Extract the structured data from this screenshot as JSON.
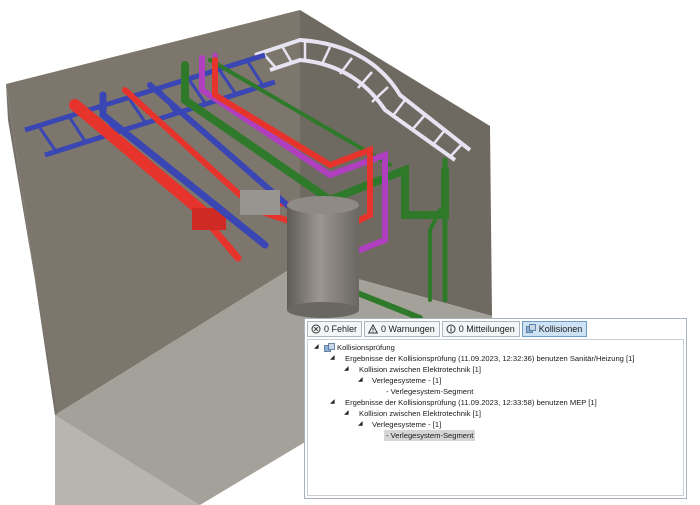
{
  "toolbar": {
    "errors": "0 Fehler",
    "warnings": "0 Warnungen",
    "messages": "0 Mitteilungen",
    "collisions": "Kollisionen"
  },
  "tree": {
    "root": "Kollisionsprüfung",
    "result1": "Ergebnisse der Kollisionsprüfung (11.09.2023, 12:32:36) benutzen Sanitär/Heizung [1]",
    "result1_collision": "Kollision zwischen Elektrotechnik [1]",
    "result1_systems": "Verlegesysteme -  [1]",
    "result1_segment": "- Verlegesystem-Segment",
    "result2": "Ergebnisse der Kollisionsprüfung (11.09.2023, 12:33:58) benutzen MEP [1]",
    "result2_collision": "Kollision zwischen Elektrotechnik [1]",
    "result2_systems": "Verlegesysteme -  [1]",
    "result2_segment": "- Verlegesystem-Segment"
  },
  "colors": {
    "wall": "#797369",
    "floor": "#a6a39c",
    "pipe_red": "#e8332b",
    "pipe_blue": "#3d47b8",
    "pipe_green": "#2f7a2a",
    "pipe_purple": "#b03fc0",
    "cable_tray_white": "#e9e4f4",
    "tank": "#8a8580",
    "selection": "#d6d6d6",
    "toolbar_active": "#cde3f5"
  }
}
